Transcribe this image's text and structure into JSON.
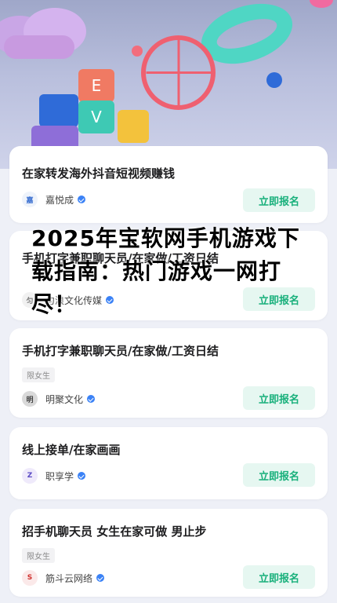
{
  "headline": "2025年宝软网手机游戏下载指南：热门游戏一网打尽！",
  "hero": {
    "block_letters": [
      "E",
      "V"
    ]
  },
  "jobs": [
    {
      "title": "在家转发海外抖音短视频赚钱",
      "tag": "",
      "company": "嘉悦成",
      "logo_text": "嘉",
      "logo_color": "#3a6fd0",
      "apply_label": "立即报名"
    },
    {
      "title": "手机打字兼职聊天员/在家做/工资日结",
      "tag": "",
      "company": "匀浪文化传媒",
      "logo_text": "匀",
      "logo_color": "#7a7a7a",
      "apply_label": "立即报名"
    },
    {
      "title": "手机打字兼职聊天员/在家做/工资日结",
      "tag": "限女生",
      "company": "明聚文化",
      "logo_text": "明",
      "logo_color": "#444444",
      "apply_label": "立即报名"
    },
    {
      "title": "线上接单/在家画画",
      "tag": "",
      "company": "职享学",
      "logo_text": "Z",
      "logo_color": "#5b4bc4",
      "apply_label": "立即报名"
    },
    {
      "title": "招手机聊天员 女生在家可做 男止步",
      "tag": "限女生",
      "company": "筋斗云网络",
      "logo_text": "S",
      "logo_color": "#d0322f",
      "apply_label": "立即报名"
    }
  ],
  "colors": {
    "accent": "#18b07b",
    "accent_bg": "#e6f7f1",
    "verify": "#3b82f6"
  }
}
